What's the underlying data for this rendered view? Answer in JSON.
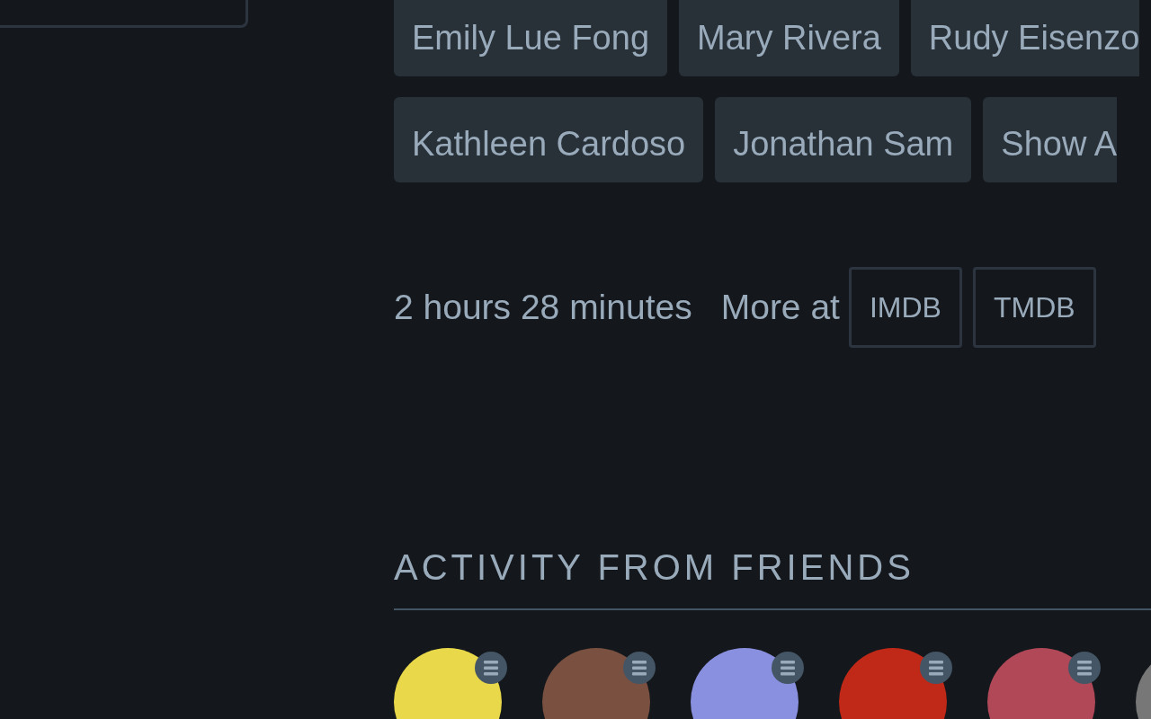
{
  "cast_rows": [
    [
      "Emily Lue Fong",
      "Mary Rivera",
      "Rudy Eisenzo"
    ],
    [
      "Kathleen Cardoso",
      "Jonathan Sam",
      "Show A"
    ]
  ],
  "runtime": "2 hours 28 minutes",
  "more_at": {
    "label": "More at",
    "links": [
      "IMDB",
      "TMDB"
    ]
  },
  "activity": {
    "heading": "ACTIVITY FROM FRIENDS"
  }
}
